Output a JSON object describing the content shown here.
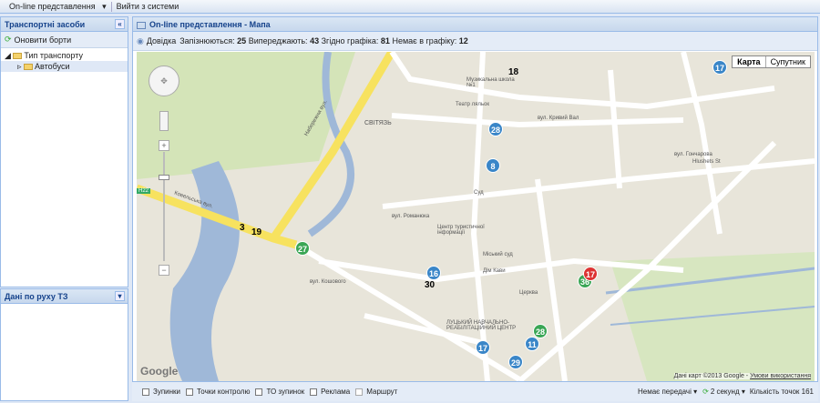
{
  "topbar": {
    "menu": "On-line представлення",
    "logout": "Вийти з системи"
  },
  "left": {
    "title": "Транспортні засоби",
    "refresh": "Оновити борти",
    "tree": [
      "Тип транспорту",
      "Автобуси"
    ],
    "lower_title": "Дані по руху ТЗ"
  },
  "main": {
    "title": "On-line представлення - Мапа",
    "status": {
      "help": "Довідка",
      "late_label": "Запізнюються:",
      "late": "25",
      "ahead_label": "Випереджають:",
      "ahead": "43",
      "ontime_label": "Згідно графіка:",
      "ontime": "81",
      "off_label": "Немає в графіку:",
      "off": "12"
    },
    "map_type": [
      "Карта",
      "Супутник"
    ],
    "attribution": "Дані карт ©2013 Google -",
    "terms": "Умови використання",
    "google": "Google",
    "labels": [
      "Набережна вул.",
      "Ковельська вул.",
      "СВІТЯЗЬ",
      "Музикальна школа №1",
      "Театр ляльок",
      "вул. Кривий Вал",
      "Суд",
      "Центр туристичної інформації",
      "Міський суд",
      "Дім Кави",
      "Церква",
      "ЛУЦЬКИЙ НАВЧАЛЬНО-РЕАБІЛІТАЦІЙНИЙ ЦЕНТР",
      "вул. Гончарова",
      "Hlushets St",
      "вул. Романюка",
      "вул. Кошового",
      "H22"
    ],
    "markers": {
      "blue": [
        "17",
        "28",
        "8",
        "16",
        "11",
        "29",
        "17"
      ],
      "green": [
        "27",
        "28",
        "36",
        "17"
      ],
      "plain": [
        "18",
        "3",
        "19",
        "30"
      ]
    }
  },
  "bottom": {
    "checkboxes": [
      "Зупинки",
      "Точки контролю",
      "ТО зупинок",
      "Реклама",
      "Маршрут"
    ],
    "no_transfer": "Немає передачі",
    "interval": "2 секунд",
    "count": "Кількість точок 161"
  },
  "colors": {
    "accent": "#15428b",
    "marker_blue": "#3a86c8",
    "marker_green": "#3aa655",
    "road_yellow": "#f7e25f"
  }
}
